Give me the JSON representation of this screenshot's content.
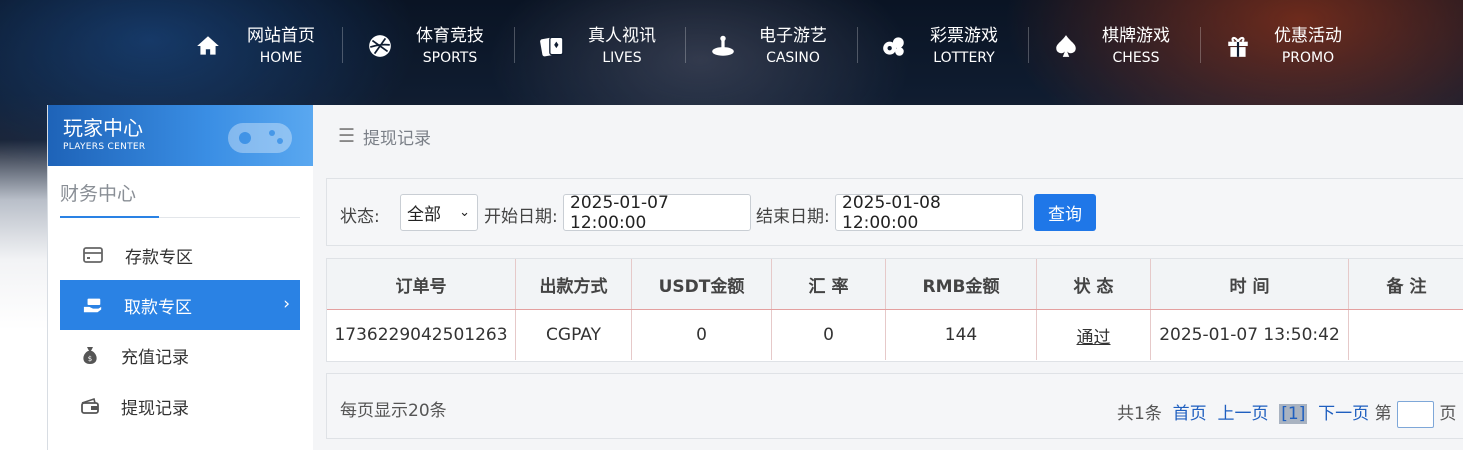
{
  "nav": [
    {
      "cn": "网站首页",
      "en": "HOME",
      "icon": "home-icon"
    },
    {
      "cn": "体育竞技",
      "en": "SPORTS",
      "icon": "ball-icon"
    },
    {
      "cn": "真人视讯",
      "en": "LIVES",
      "icon": "cards-icon"
    },
    {
      "cn": "电子游艺",
      "en": "CASINO",
      "icon": "roulette-icon"
    },
    {
      "cn": "彩票游戏",
      "en": "LOTTERY",
      "icon": "lottery-balls-icon"
    },
    {
      "cn": "棋牌游戏",
      "en": "CHESS",
      "icon": "spade-icon"
    },
    {
      "cn": "优惠活动",
      "en": "PROMO",
      "icon": "gift-icon"
    }
  ],
  "sidebar": {
    "title": "玩家中心",
    "subtitle": "PLAYERS CENTER",
    "section": "财务中心",
    "items": [
      {
        "label": "存款专区",
        "icon": "card-icon",
        "active": false
      },
      {
        "label": "取款专区",
        "icon": "hand-cash-icon",
        "active": true
      },
      {
        "label": "充值记录",
        "icon": "money-bag-icon",
        "active": false
      },
      {
        "label": "提现记录",
        "icon": "wallet-icon",
        "active": false
      }
    ]
  },
  "breadcrumb": {
    "title": "提现记录",
    "icon": "menu-icon"
  },
  "filter": {
    "status_label": "状态:",
    "status_value": "全部",
    "start_label": "开始日期:",
    "start_value": "2025-01-07 12:00:00",
    "end_label": "结束日期:",
    "end_value": "2025-01-08 12:00:00",
    "query_button": "查询"
  },
  "table": {
    "headers": [
      "订单号",
      "出款方式",
      "USDT金额",
      "汇 率",
      "RMB金额",
      "状 态",
      "时 间",
      "备 注"
    ],
    "rows": [
      [
        "1736229042501263",
        "CGPAY",
        "0",
        "0",
        "144",
        "通过",
        "2025-01-07 13:50:42",
        ""
      ]
    ]
  },
  "pager": {
    "per_page": "每页显示20条",
    "total": "共1条",
    "first": "首页",
    "prev": "上一页",
    "current": "[1]",
    "next": "下一页",
    "goto_prefix": "第",
    "goto_suffix": "页"
  },
  "colors": {
    "accent": "#2a82e4",
    "button": "#1f77e8"
  }
}
